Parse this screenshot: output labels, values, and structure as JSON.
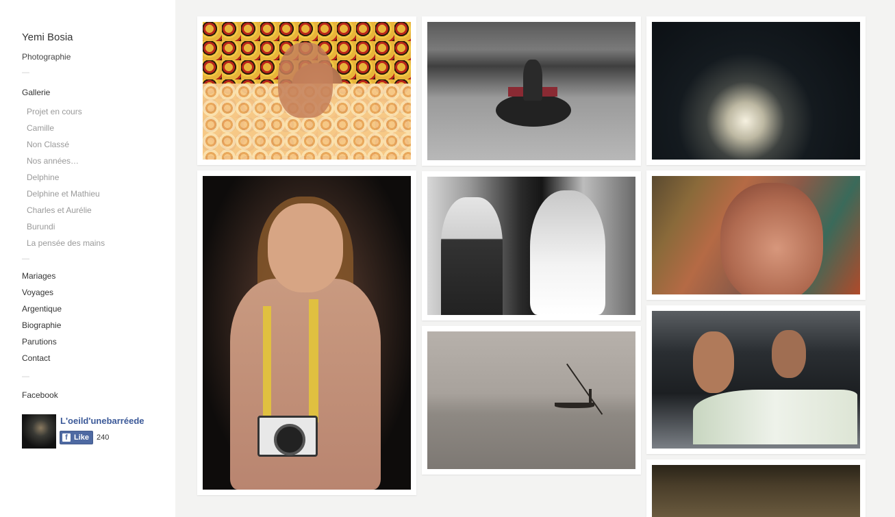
{
  "sidebar": {
    "site_title": "Yemi Bosia",
    "site_subtitle": "Photographie",
    "separator": "—",
    "gallery_heading": "Gallerie",
    "gallery_items": [
      {
        "label": "Projet en cours"
      },
      {
        "label": "Camille"
      },
      {
        "label": "Non Classé"
      },
      {
        "label": "Nos années…"
      },
      {
        "label": "Delphine"
      },
      {
        "label": "Delphine et Mathieu"
      },
      {
        "label": "Charles et Aurélie"
      },
      {
        "label": "Burundi"
      },
      {
        "label": "La pensée des mains"
      }
    ],
    "main_items": [
      {
        "label": "Mariages"
      },
      {
        "label": "Voyages"
      },
      {
        "label": "Argentique"
      },
      {
        "label": "Biographie"
      },
      {
        "label": "Parutions"
      },
      {
        "label": "Contact"
      }
    ],
    "facebook_label": "Facebook",
    "fb_widget": {
      "page_name": "L'oeild'unebarréede",
      "like_label": "Like",
      "like_icon": "f",
      "like_count": "240"
    }
  },
  "colors": {
    "background": "#f3f3f2",
    "sidebar_bg": "#ffffff",
    "fb_blue": "#4e69a2"
  }
}
